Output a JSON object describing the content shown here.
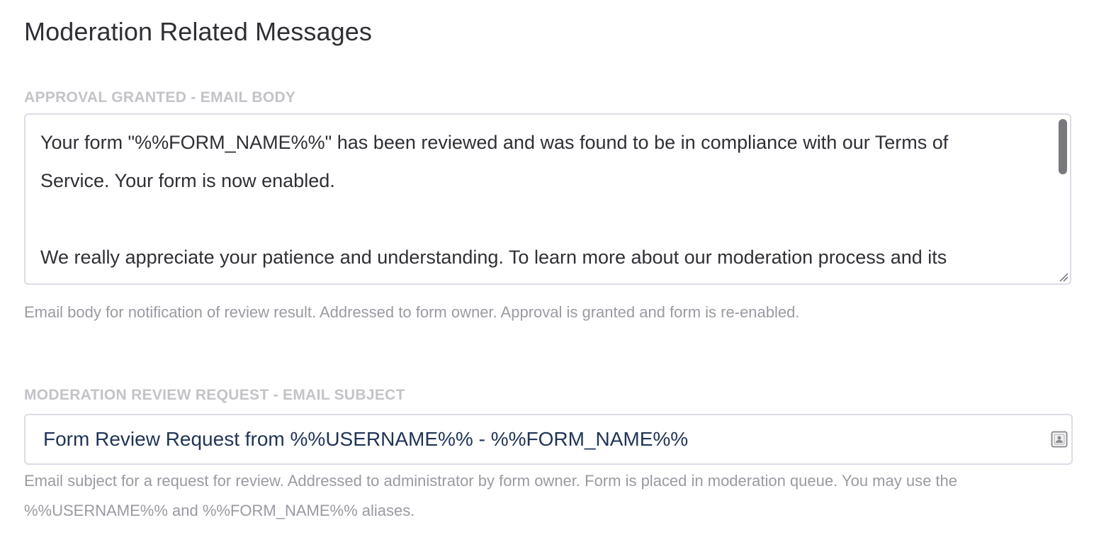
{
  "section": {
    "title": "Moderation Related Messages"
  },
  "approval_granted": {
    "label": "APPROVAL GRANTED - EMAIL BODY",
    "body_lines": [
      "Your form \"%%FORM_NAME%%\" has been reviewed and was found to be in compliance with our Terms of",
      "Service. Your form is now enabled.",
      "",
      "We really appreciate your patience and understanding. To learn more about our moderation process and its"
    ],
    "help": "Email body for notification of review result. Addressed to form owner. Approval is granted and form is re-enabled."
  },
  "review_request": {
    "label": "MODERATION REVIEW REQUEST - EMAIL SUBJECT",
    "value": "Form Review Request from %%USERNAME%% - %%FORM_NAME%%",
    "icon": "contact-card-icon",
    "help": "Email subject for a request for review. Addressed to administrator by form owner. Form is placed in moderation queue. You may use the %%USERNAME%% and %%FORM_NAME%% aliases."
  },
  "colors": {
    "text": "#2f2f35",
    "label": "#c3c3c8",
    "help": "#9a9aa2",
    "input_text": "#1f3457",
    "border": "#dcdce8"
  }
}
